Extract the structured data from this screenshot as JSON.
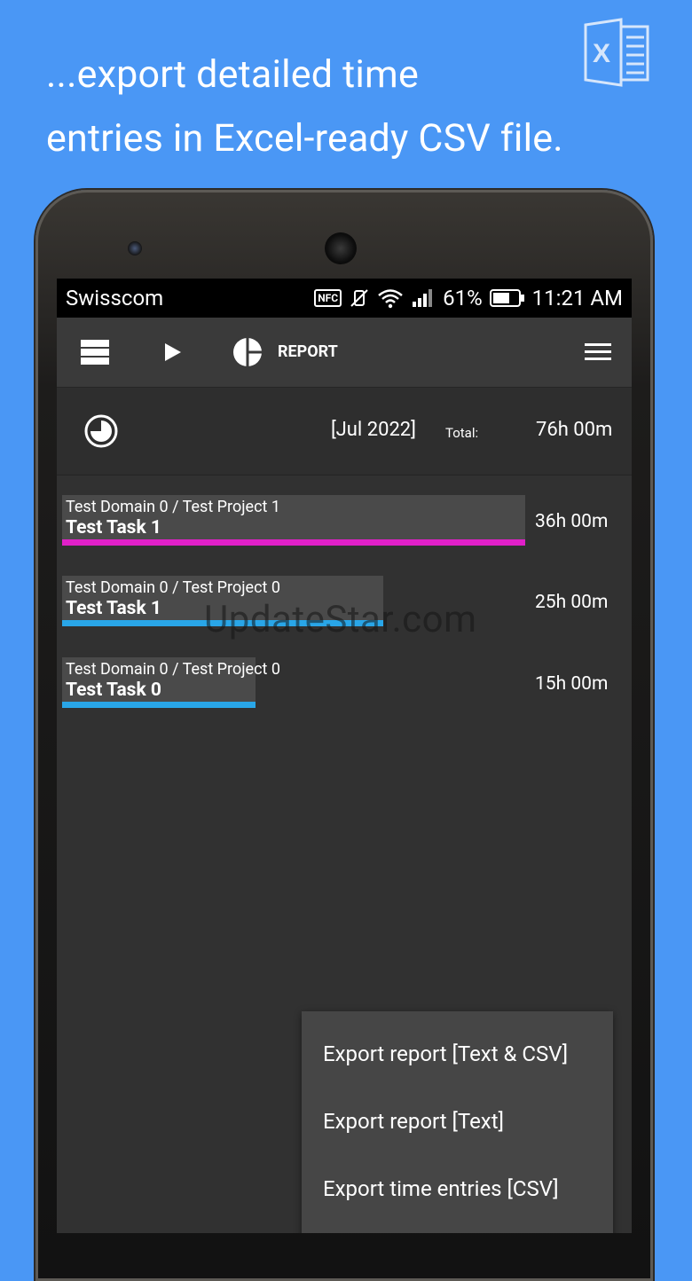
{
  "headline": {
    "line1": "...export detailed time",
    "line2": "entries in Excel-ready CSV file."
  },
  "excel_icon": {
    "icon": "excel-icon",
    "color": "#d6e6fb"
  },
  "status_bar": {
    "carrier": "Swisscom",
    "nfc": "NFC",
    "battery": "61%",
    "time": "11:21 AM"
  },
  "toolbar": {
    "report_label": "REPORT",
    "icons": [
      "list-icon",
      "play-icon",
      "pie-chart-icon",
      "hamburger-menu-icon"
    ]
  },
  "summary": {
    "period": "[Jul 2022]",
    "total_label": "Total:",
    "total_value": "76h 00m"
  },
  "entries": [
    {
      "project": "Test Domain 0 / Test Project 1",
      "task": "Test Task 1",
      "duration": "36h 00m",
      "color": "#e020c8",
      "share": 0.4737
    },
    {
      "project": "Test Domain 0 / Test Project 0",
      "task": "Test Task 1",
      "duration": "25h 00m",
      "color": "#29a6e8",
      "share": 0.3289
    },
    {
      "project": "Test Domain 0 / Test Project 0",
      "task": "Test Task 0",
      "duration": "15h 00m",
      "color": "#29a6e8",
      "share": 0.1974
    }
  ],
  "watermark": "UpdateStar.com",
  "menu": {
    "items": [
      "Export report [Text & CSV]",
      "Export report [Text]",
      "Export time entries [CSV]"
    ]
  },
  "colors": {
    "background": "#4a97f5",
    "screen": "#313131",
    "toolbar": "#3a3a3a",
    "menu": "#464646"
  }
}
